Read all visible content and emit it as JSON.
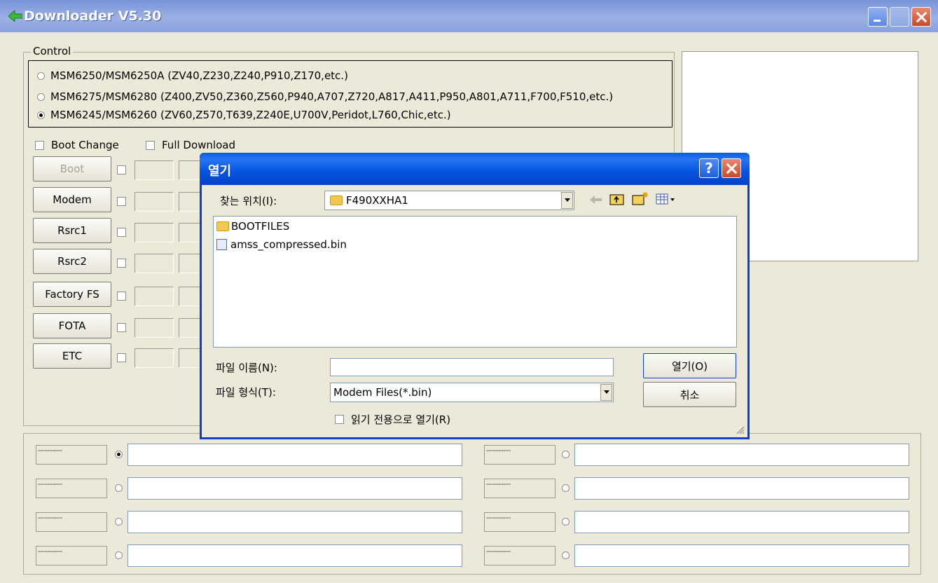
{
  "window": {
    "title": "Downloader V5.30"
  },
  "control": {
    "group_label": "Control",
    "options": [
      {
        "label": "MSM6250/MSM6250A (ZV40,Z230,Z240,P910,Z170,etc.)",
        "selected": false
      },
      {
        "label": "MSM6275/MSM6280 (Z400,ZV50,Z360,Z560,P940,A707,Z720,A817,A411,P950,A801,A711,F700,F510,etc.)",
        "selected": false
      },
      {
        "label": "MSM6245/MSM6260 (ZV60,Z570,T639,Z240E,U700V,Peridot,L760,Chic,etc.)",
        "selected": true
      }
    ],
    "boot_change_label": "Boot Change",
    "full_download_label": "Full Download",
    "buttons": [
      "Boot",
      "Modem",
      "Rsrc1",
      "Rsrc2",
      "Factory FS",
      "FOTA",
      "ETC"
    ]
  },
  "ports": {
    "placeholder": "----------",
    "left_selected": 0
  },
  "dialog": {
    "title": "열기",
    "help_label": "?",
    "look_in_label": "찾는 위치(I):",
    "look_in_value": "F490XXHA1",
    "files": [
      {
        "name": "BOOTFILES",
        "type": "folder"
      },
      {
        "name": "amss_compressed.bin",
        "type": "file"
      }
    ],
    "filename_label": "파일 이름(N):",
    "filename_value": "",
    "filetype_label": "파일 형식(T):",
    "filetype_value": "Modem Files(*.bin)",
    "readonly_label": "읽기 전용으로 열기(R)",
    "open_button": "열기(O)",
    "cancel_button": "취소"
  }
}
